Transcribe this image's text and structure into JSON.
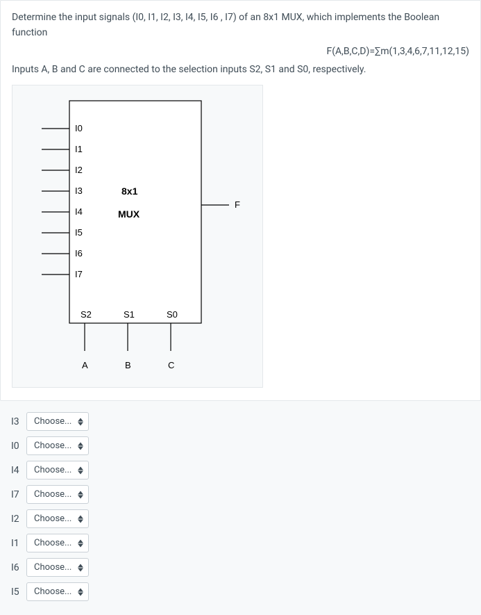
{
  "question": {
    "intro": "Determine the input signals (I0, I1, I2, I3, I4, I5, I6 , I7) of an 8x1 MUX, which implements the Boolean function",
    "formula": "F(A,B,C,D)=∑m(1,3,4,6,7,11,12,15)",
    "selection_note": "Inputs A, B and C are connected to the selection inputs S2, S1 and S0, respectively."
  },
  "diagram": {
    "inputs": [
      "I0",
      "I1",
      "I2",
      "I3",
      "I4",
      "I5",
      "I6",
      "I7"
    ],
    "title1": "8x1",
    "title2": "MUX",
    "output": "F",
    "selects": [
      "S2",
      "S1",
      "S0"
    ],
    "select_vars": [
      "A",
      "B",
      "C"
    ]
  },
  "answers": {
    "placeholder": "Choose...",
    "rows": [
      "I3",
      "I0",
      "I4",
      "I7",
      "I2",
      "I1",
      "I6",
      "I5"
    ]
  }
}
